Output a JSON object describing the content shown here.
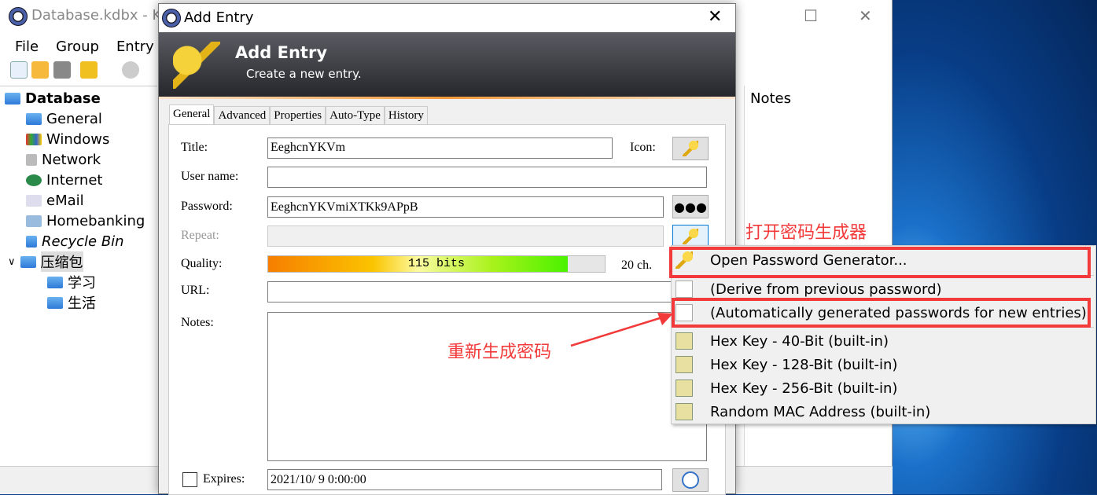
{
  "main_window": {
    "title": "Database.kdbx - KeePass",
    "menu": [
      "File",
      "Group",
      "Entry"
    ],
    "tree": {
      "root": "Database",
      "items": [
        "General",
        "Windows",
        "Network",
        "Internet",
        "eMail",
        "Homebanking",
        "Recycle Bin"
      ],
      "group": "压缩包",
      "subitems": [
        "学习",
        "生活"
      ]
    },
    "column_header": "Notes"
  },
  "dialog": {
    "title": "Add Entry",
    "banner_title": "Add Entry",
    "banner_subtitle": "Create a new entry.",
    "tabs": [
      "General",
      "Advanced",
      "Properties",
      "Auto-Type",
      "History"
    ],
    "active_tab": "General",
    "fields": {
      "title_label": "Title:",
      "title_value": "EeghcnYKVm",
      "icon_label": "Icon:",
      "username_label": "User name:",
      "username_value": "",
      "password_label": "Password:",
      "password_value": "EeghcnYKVmiXTKk9APpB",
      "repeat_label": "Repeat:",
      "quality_label": "Quality:",
      "quality_text": "115 bits",
      "quality_fraction": 0.89,
      "length_text": "20 ch.",
      "url_label": "URL:",
      "notes_label": "Notes:",
      "expires_label": "Expires:",
      "expires_value": "2021/10/ 9  0:00:00",
      "expires_checked": false
    }
  },
  "context_menu": {
    "items": [
      "Open Password Generator...",
      "(Derive from previous password)",
      "(Automatically generated passwords for new entries)",
      "Hex Key - 40-Bit (built-in)",
      "Hex Key - 128-Bit (built-in)",
      "Hex Key - 256-Bit (built-in)",
      "Random MAC Address (built-in)"
    ]
  },
  "annotations": {
    "open_generator": "打开密码生成器",
    "regenerate": "重新生成密码",
    "color": "#f23a3a"
  }
}
